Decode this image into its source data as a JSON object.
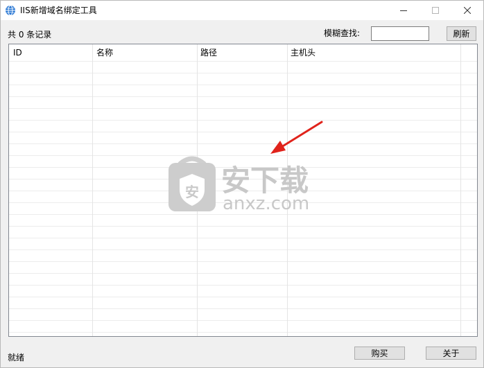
{
  "window": {
    "title": "IIS新增域名绑定工具",
    "icons": {
      "app": "globe-icon",
      "minimize": "minimize-icon",
      "maximize": "maximize-icon",
      "close": "close-icon"
    }
  },
  "toolbar": {
    "record_count": "共 0 条记录",
    "search_label": "模糊查找:",
    "search_value": "",
    "refresh_label": "刷新"
  },
  "table": {
    "columns": [
      "ID",
      "名称",
      "路径",
      "主机头"
    ],
    "rows": []
  },
  "watermark": {
    "title": "安下载",
    "domain": "anxz.com",
    "badge": "安"
  },
  "statusbar": {
    "status": "就绪",
    "buy_label": "购买",
    "about_label": "关于"
  },
  "colors": {
    "arrow": "#e0231b",
    "watermark": "#c8c8c8",
    "grid_border": "#828790"
  }
}
